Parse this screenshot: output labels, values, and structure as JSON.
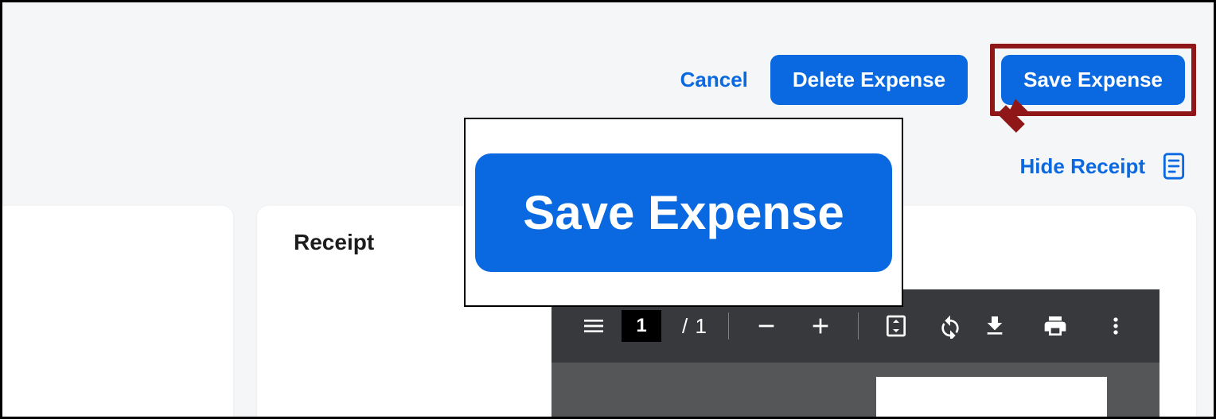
{
  "colors": {
    "primary": "#0a69e0",
    "annotation": "#8f1717",
    "toolbar": "#38393c"
  },
  "actions": {
    "cancel": "Cancel",
    "delete": "Delete Expense",
    "save": "Save Expense"
  },
  "receipt": {
    "hide_label": "Hide Receipt",
    "heading": "Receipt"
  },
  "callout": {
    "save": "Save Expense"
  },
  "pdf_viewer": {
    "current_page": "1",
    "page_separator": "/",
    "total_pages": "1"
  }
}
